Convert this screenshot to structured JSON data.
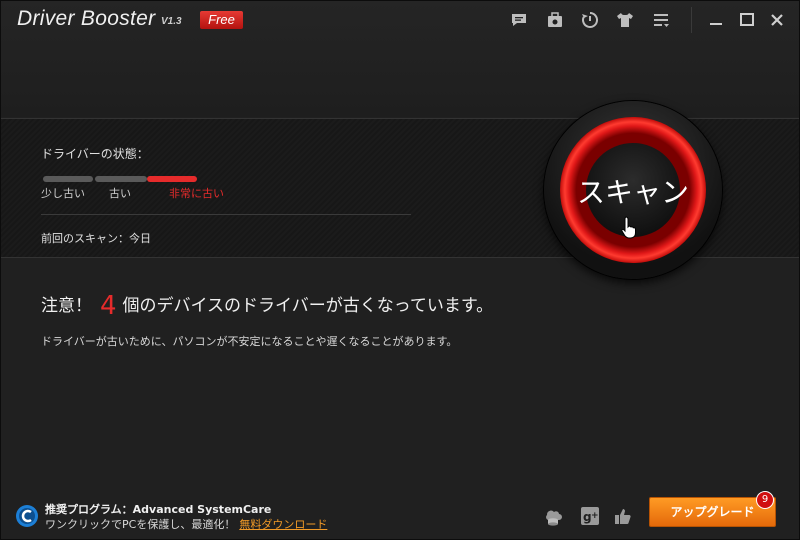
{
  "window": {
    "title": "Driver Booster",
    "version": "V1.3",
    "edition_badge": "Free",
    "toolbar_icons": [
      "feedback-icon",
      "toolbox-icon",
      "restore-icon",
      "skin-icon",
      "menu-icon"
    ],
    "controls": [
      "minimize-icon",
      "maximize-icon",
      "close-icon"
    ]
  },
  "status": {
    "label": "ドライバーの状態：",
    "levels": [
      {
        "label": "少し古い",
        "color": "#d0d0d0"
      },
      {
        "label": "古い",
        "color": "#d0d0d0"
      },
      {
        "label": "非常に古い",
        "color": "#e62b2b"
      }
    ],
    "current_level": "非常に古い",
    "last_scan": "前回のスキャン：今日"
  },
  "scan_button": {
    "label": "スキャン"
  },
  "warning": {
    "prefix": "注意！",
    "count": "4",
    "suffix": "個のデバイスのドライバーが古くなっています。",
    "description": "ドライバーが古いために、パソコンが不安定になることや遅くなることがあります。"
  },
  "footer": {
    "recommend_title": "推奨プログラム：Advanced SystemCare",
    "recommend_desc": "ワンクリックでPCを保護し、最適化！",
    "download_link": "無料ダウンロード",
    "social_icons": [
      "cloud-database-icon",
      "google-plus-icon",
      "thumbs-up-icon"
    ],
    "upgrade_label": "アップグレード",
    "upgrade_badge": "9"
  },
  "colors": {
    "accent_red": "#e62b2b",
    "upgrade_orange": "#f28a1a",
    "link_orange": "#f29a26",
    "background": "#202020"
  }
}
